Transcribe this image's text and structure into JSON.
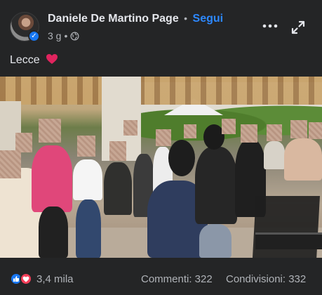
{
  "header": {
    "page_name": "Daniele De Martino Page",
    "separator": "•",
    "follow_label": "Segui",
    "time": "3 g",
    "separator2": "•"
  },
  "post": {
    "caption": "Lecce",
    "caption_emoji": "heart-icon"
  },
  "footer": {
    "reaction_count": "3,4 mila",
    "comments": "Commenti: 322",
    "shares": "Condivisioni: 332"
  },
  "colors": {
    "background": "#242526",
    "accent": "#2d88ff",
    "like": "#1877f2",
    "love": "#f33e58"
  },
  "icons": [
    "globe-icon",
    "more-icon",
    "expand-icon",
    "verified-badge-icon",
    "like-icon",
    "love-icon"
  ]
}
